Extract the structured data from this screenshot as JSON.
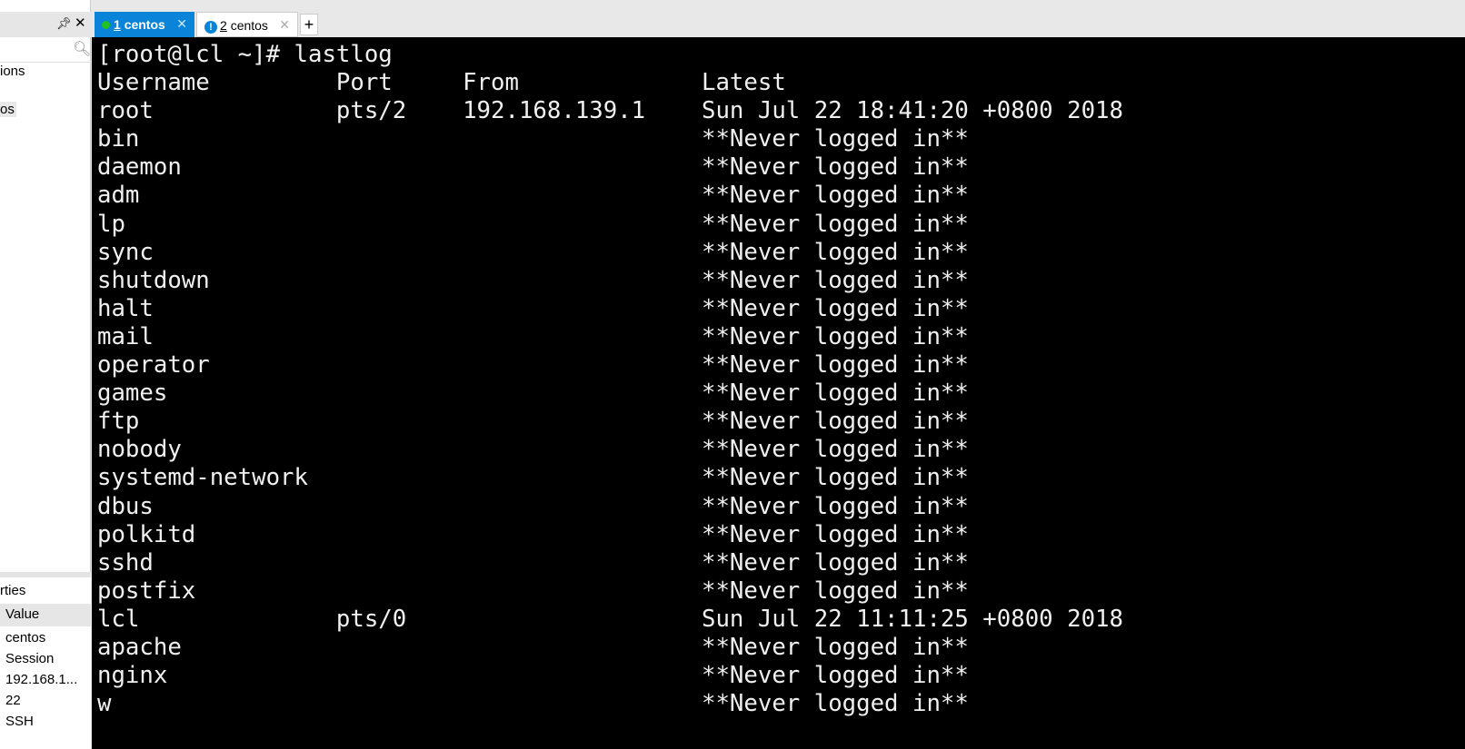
{
  "left_panel": {
    "sessions": [
      "ions",
      "os"
    ],
    "search_icon": "magnifier-icon",
    "properties": {
      "title": "rties",
      "column": "Value",
      "values": [
        "centos",
        "Session",
        "192.168.1...",
        "22",
        "SSH"
      ]
    }
  },
  "tabs": [
    {
      "num": "1",
      "label": "centos",
      "status": "connected"
    },
    {
      "num": "2",
      "label": "centos",
      "status": "warning"
    }
  ],
  "terminal": {
    "prompt": "[root@lcl ~]# lastlog",
    "headers": [
      "Username",
      "Port",
      "From",
      "Latest"
    ],
    "rows": [
      [
        "root",
        "pts/2",
        "192.168.139.1",
        "Sun Jul 22 18:41:20 +0800 2018"
      ],
      [
        "bin",
        "",
        "",
        "**Never logged in**"
      ],
      [
        "daemon",
        "",
        "",
        "**Never logged in**"
      ],
      [
        "adm",
        "",
        "",
        "**Never logged in**"
      ],
      [
        "lp",
        "",
        "",
        "**Never logged in**"
      ],
      [
        "sync",
        "",
        "",
        "**Never logged in**"
      ],
      [
        "shutdown",
        "",
        "",
        "**Never logged in**"
      ],
      [
        "halt",
        "",
        "",
        "**Never logged in**"
      ],
      [
        "mail",
        "",
        "",
        "**Never logged in**"
      ],
      [
        "operator",
        "",
        "",
        "**Never logged in**"
      ],
      [
        "games",
        "",
        "",
        "**Never logged in**"
      ],
      [
        "ftp",
        "",
        "",
        "**Never logged in**"
      ],
      [
        "nobody",
        "",
        "",
        "**Never logged in**"
      ],
      [
        "systemd-network",
        "",
        "",
        "**Never logged in**"
      ],
      [
        "dbus",
        "",
        "",
        "**Never logged in**"
      ],
      [
        "polkitd",
        "",
        "",
        "**Never logged in**"
      ],
      [
        "sshd",
        "",
        "",
        "**Never logged in**"
      ],
      [
        "postfix",
        "",
        "",
        "**Never logged in**"
      ],
      [
        "lcl",
        "pts/0",
        "",
        "Sun Jul 22 11:11:25 +0800 2018"
      ],
      [
        "apache",
        "",
        "",
        "**Never logged in**"
      ],
      [
        "nginx",
        "",
        "",
        "**Never logged in**"
      ],
      [
        "w",
        "",
        "",
        "**Never logged in**"
      ]
    ]
  }
}
